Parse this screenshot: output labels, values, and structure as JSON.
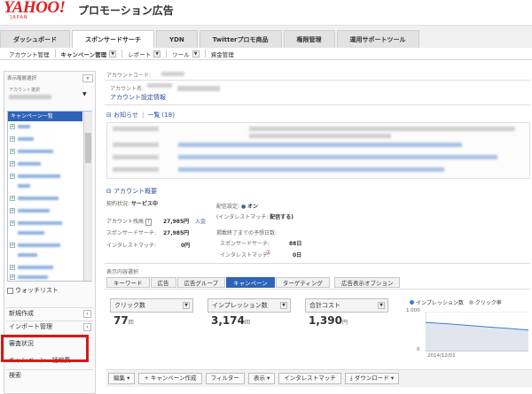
{
  "brand": {
    "logo": "YAHOO!",
    "logo_sub": "JAPAN",
    "product": "プロモーション広告",
    "logo_color": "#e02020"
  },
  "main_tabs": [
    "ダッシュボード",
    "スポンサードサーチ",
    "YDN",
    "Twitterプロモ商品",
    "権限管理",
    "運用サポートツール"
  ],
  "sub_nav": {
    "account_mgmt": "アカウント管理",
    "campaign_mgmt": "キャンペーン管理",
    "report": "レポート",
    "tool": "ツール",
    "funds": "資金管理"
  },
  "sidebar": {
    "heading": "表示階層選択",
    "account_label": "アカウント選択",
    "campaign_list_title": "キャンペーン一覧",
    "watchlist": "ウォッチリスト",
    "links": [
      "新規作成",
      "インポート管理",
      "審査状況",
      "キャンペーン一括編集",
      "検索"
    ]
  },
  "account": {
    "name_label": "アカウント名:",
    "settings_link": "アカウント設定情報"
  },
  "notice": {
    "title": "お知らせ",
    "count": "一覧 (18)"
  },
  "overview": {
    "title": "アカウント概要",
    "contract_label": "契約状況:",
    "contract_value": "サービス中",
    "balance_label": "アカウント残高",
    "balance_value": "27,985円",
    "deposit_link": "入金",
    "ss_label": "スポンサードサーチ:",
    "ss_value": "27,985円",
    "im_label": "インタレストマッチ:",
    "im_value": "0円",
    "delivery_label": "配信設定:",
    "delivery_value": "オン",
    "im_delivery_label": "(インタレストマッチ:",
    "im_delivery_value": "配信する)",
    "forecast_label": "掲載終了までの予想日数:",
    "ss_days_label": "スポンサードサーチ:",
    "ss_days": "88日",
    "im_days_label": "インタレストマッチ:",
    "im_days": "0日"
  },
  "display_label": "表示内容選択",
  "display_tabs": [
    "キーワード",
    "広告",
    "広告グループ",
    "キャンペーン",
    "ターゲティング",
    "広告表示オプション"
  ],
  "metrics": [
    {
      "label": "クリック数",
      "value": "77",
      "unit": "回"
    },
    {
      "label": "インプレッション数",
      "value": "3,174",
      "unit": "回"
    },
    {
      "label": "合計コスト",
      "value": "1,390",
      "unit": "円"
    }
  ],
  "chart_data": {
    "type": "line",
    "series": [
      {
        "name": "インプレッション数",
        "values": [
          720,
          690,
          650,
          610,
          570,
          530
        ]
      }
    ],
    "y_ticks": [
      "1,000",
      "0"
    ],
    "ylim": [
      0,
      1000
    ],
    "x_tick": "2014/12/01",
    "legend": [
      "インプレッション数",
      "クリック率"
    ],
    "colors": [
      "#3b7bd6",
      "#bbbbbb"
    ]
  },
  "toolbar": [
    "編集",
    "キャンペーン作成",
    "フィルター",
    "表示",
    "インタレストマッチ",
    "ダウンロード"
  ],
  "colors": {
    "accent": "#2e63b8",
    "highlight": "#d21b1b"
  }
}
